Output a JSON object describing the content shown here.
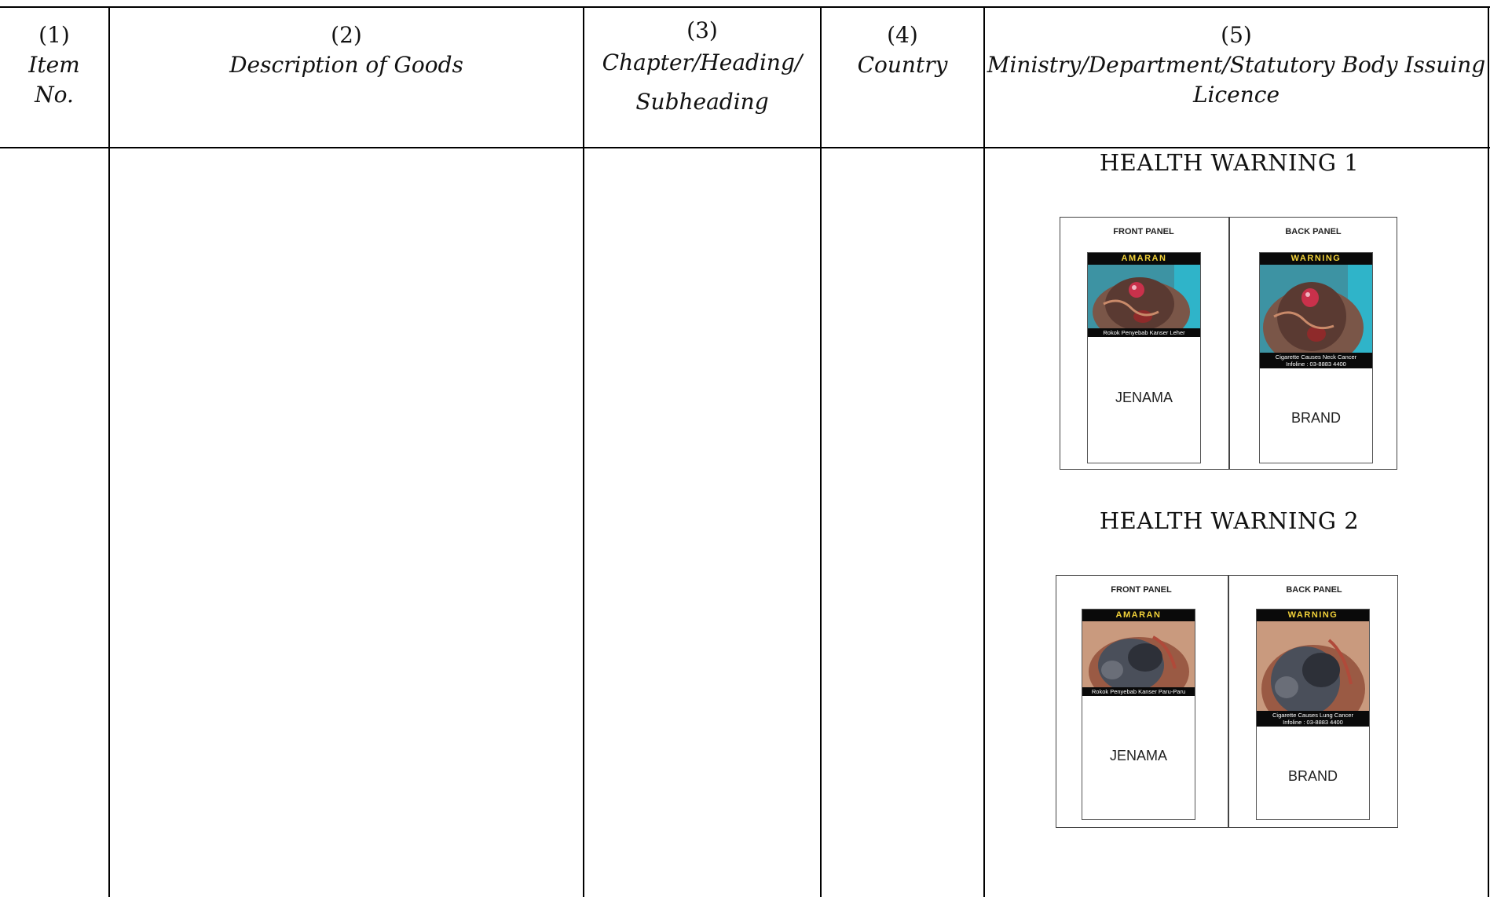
{
  "headers": [
    {
      "num": "(1)",
      "label_line1": "Item",
      "label_line2": "No."
    },
    {
      "num": "(2)",
      "label_line1": "Description of Goods",
      "label_line2": ""
    },
    {
      "num": "(3)",
      "label_line1": "Chapter/Heading/",
      "label_line2": "Subheading"
    },
    {
      "num": "(4)",
      "label_line1": "Country",
      "label_line2": ""
    },
    {
      "num": "(5)",
      "label_line1": "Ministry/Department/Statutory Body Issuing",
      "label_line2": "Licence"
    }
  ],
  "warnings": [
    {
      "title": "HEALTH WARNING 1",
      "front": {
        "panel_label": "FRONT PANEL",
        "band": "AMARAN",
        "caption": "Rokok Penyebab Kanser Leher",
        "brand": "JENAMA"
      },
      "back": {
        "panel_label": "BACK PANEL",
        "band": "WARNING",
        "caption_line1": "Cigarette Causes Neck Cancer",
        "caption_line2": "Infoline : 03-8883 4400",
        "brand": "BRAND"
      }
    },
    {
      "title": "HEALTH WARNING 2",
      "front": {
        "panel_label": "FRONT PANEL",
        "band": "AMARAN",
        "caption": "Rokok Penyebab Kanser Paru-Paru",
        "brand": "JENAMA"
      },
      "back": {
        "panel_label": "BACK PANEL",
        "band": "WARNING",
        "caption_line1": "Cigarette Causes Lung Cancer",
        "caption_line2": "Infoline : 03-8883 4400",
        "brand": "BRAND"
      }
    }
  ],
  "colors": {
    "band_text": "#f3d33a",
    "band_bg": "#0a0a0a",
    "rule": "#000000"
  }
}
